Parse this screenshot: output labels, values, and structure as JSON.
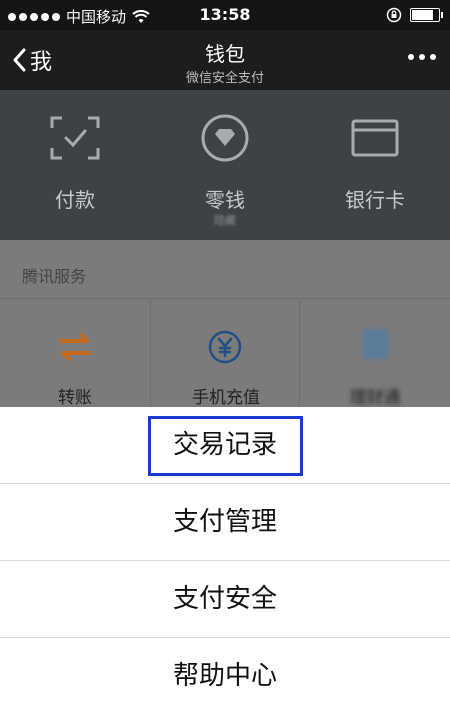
{
  "status_bar": {
    "carrier": "中国移动",
    "time": "13:58"
  },
  "nav": {
    "back_label": "我",
    "title": "钱包",
    "subtitle": "微信安全支付"
  },
  "wallet": {
    "items": [
      {
        "label": "付款",
        "icon": "scan-pay-icon"
      },
      {
        "label": "零钱",
        "sublabel": "隐藏",
        "icon": "diamond-coin-icon"
      },
      {
        "label": "银行卡",
        "icon": "bank-card-icon"
      }
    ]
  },
  "services": {
    "title": "腾讯服务",
    "items": [
      {
        "label": "转账",
        "icon": "transfer-arrows-icon"
      },
      {
        "label": "手机充值",
        "icon": "yuan-circle-icon"
      },
      {
        "label": "理财通",
        "icon": "wealth-icon"
      }
    ]
  },
  "action_sheet": {
    "items": [
      "交易记录",
      "支付管理",
      "支付安全",
      "帮助中心"
    ]
  },
  "colors": {
    "accent_orange": "#e0852a",
    "accent_blue": "#2d6fb5",
    "highlight_border": "#1a3bd0"
  }
}
